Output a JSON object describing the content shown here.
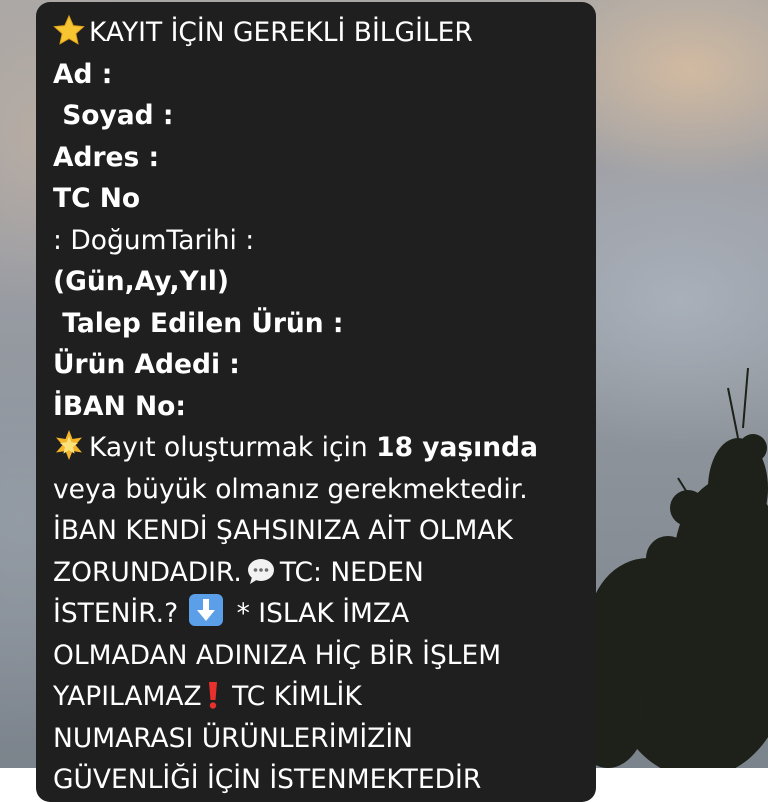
{
  "message": {
    "title": "KAYIT İÇİN GEREKLİ BİLGİLER",
    "fields": {
      "ad": "Ad :",
      "soyad": " Soyad :",
      "adres": "Adres :",
      "tc_no": "TC No",
      "dogum_tarihi": ": DoğumTarihi :",
      "tarih_format": "(Gün,Ay,Yıl)",
      "talep_urun": " Talep Edilen Ürün :",
      "urun_adedi": "Ürün Adedi :",
      "iban": "İBAN No:"
    },
    "note": {
      "intro": "Kayıt oluşturmak için ",
      "age": "18 yaşında",
      "cont1": "veya büyük olmanız gerekmektedir.",
      "cont2": "İBAN KENDİ ŞAHSINIZA AİT OLMAK",
      "cont3a": "ZORUNDADIR.",
      "cont3b": "TC: NEDEN",
      "cont4a": "İSTENİR.?",
      "cont4b": " * ISLAK İMZA",
      "cont5": "OLMADAN ADINIZA HİÇ BİR İŞLEM",
      "cont6a": "YAPILAMAZ",
      "cont6b": " TC KİMLİK",
      "cont7": "NUMARASI ÜRÜNLERİMİZİN",
      "cont8": "GÜVENLİĞİ İÇİN İSTENMEKTEDİR"
    }
  },
  "icons": {
    "title": "star-emoji",
    "note": "glowing-star-emoji",
    "speech": "speech-bubble-emoji",
    "arrow": "down-arrow-emoji",
    "exclamation": "red-exclamation-emoji"
  },
  "colors": {
    "bubble": "#1f1f1f",
    "text": "#ffffff",
    "star": "#f7c531",
    "arrow_bg": "#5a9fe8",
    "exclamation": "#e8312c"
  }
}
